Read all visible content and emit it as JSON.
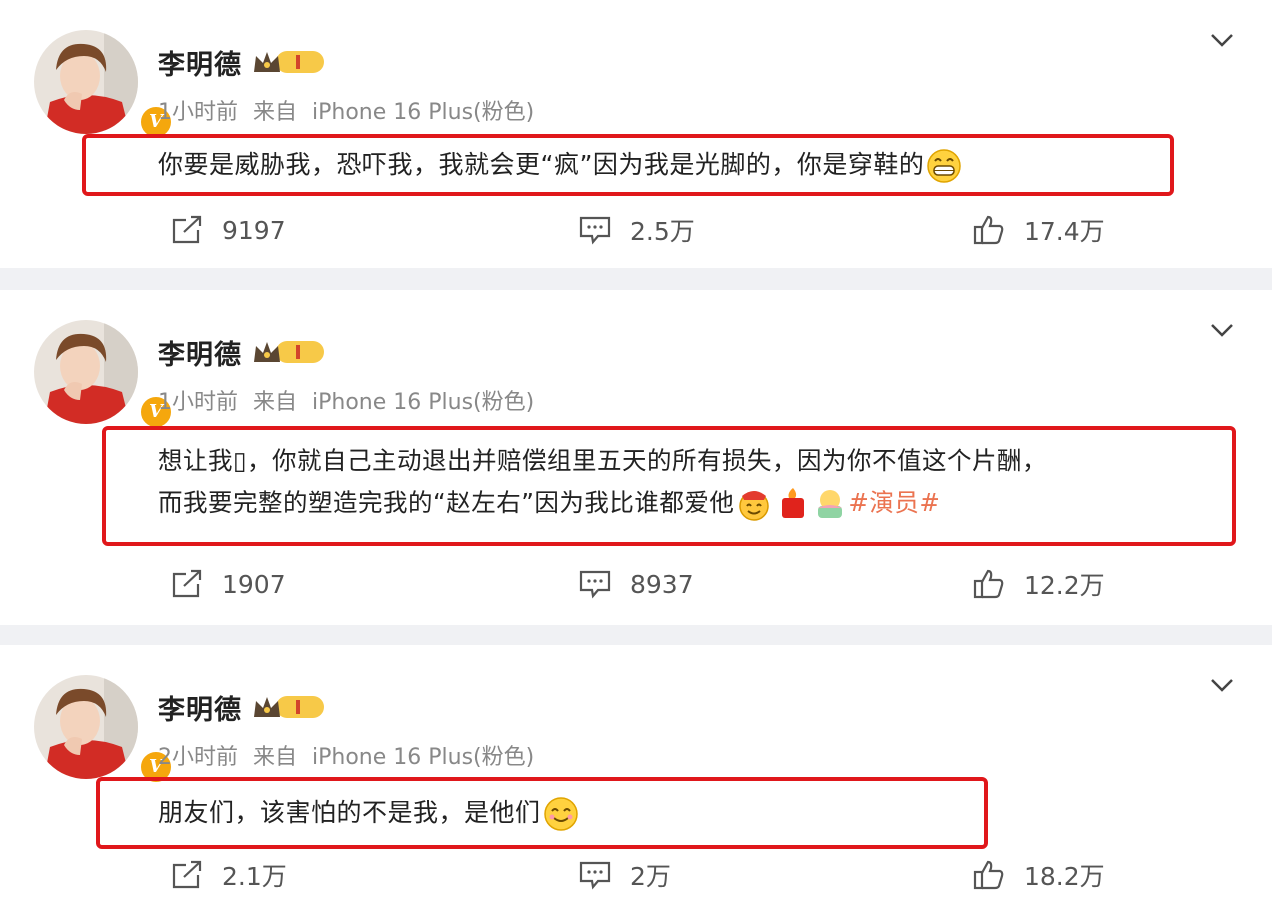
{
  "colors": {
    "highlight_box": "#e0171b",
    "hashtag": "#eb7350",
    "verified_badge": "#f5a70d"
  },
  "posts": [
    {
      "user_name": "李明德",
      "time": "1小时前",
      "source_prefix": "来自",
      "source": "iPhone 16 Plus(粉色)",
      "text_lines": [
        "你要是威胁我，恐吓我，我就会更“疯”因为我是光脚的，你是穿鞋的"
      ],
      "hashtag": "",
      "emojis": [
        "grin-emoji"
      ],
      "reposts": "9197",
      "comments": "2.5万",
      "likes": "17.4万"
    },
    {
      "user_name": "李明德",
      "time": "1小时前",
      "source_prefix": "来自",
      "source": "iPhone 16 Plus(粉色)",
      "text_lines": [
        "想让我▯，你就自己主动退出并赔偿组里五天的所有损失，因为你不值这个片酬，",
        "而我要完整的塑造完我的“赵左右”因为我比谁都爱他"
      ],
      "hashtag": "#演员#",
      "emojis": [
        "cheer-face-emoji",
        "red-envelope-emoji",
        "cake-emoji"
      ],
      "reposts": "1907",
      "comments": "8937",
      "likes": "12.2万"
    },
    {
      "user_name": "李明德",
      "time": "2小时前",
      "source_prefix": "来自",
      "source": "iPhone 16 Plus(粉色)",
      "text_lines": [
        "朋友们，该害怕的不是我，是他们"
      ],
      "hashtag": "",
      "emojis": [
        "smile-emoji"
      ],
      "reposts": "2.1万",
      "comments": "2万",
      "likes": "18.2万"
    }
  ]
}
